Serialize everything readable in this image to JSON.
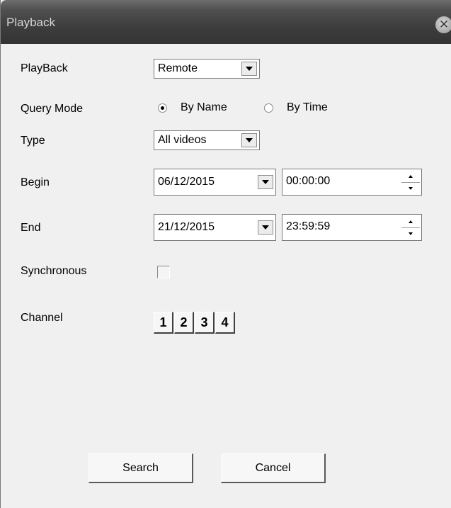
{
  "window": {
    "title": "Playback",
    "close_glyph": "✕",
    "close_icon": "close-icon"
  },
  "form": {
    "playback": {
      "label": "PlayBack",
      "value": "Remote"
    },
    "query_mode": {
      "label": "Query Mode",
      "options": [
        {
          "label": "By Name",
          "selected": true
        },
        {
          "label": "By Time",
          "selected": false
        }
      ]
    },
    "type": {
      "label": "Type",
      "value": "All videos"
    },
    "begin": {
      "label": "Begin",
      "date": "06/12/2015",
      "time": "00:00:00"
    },
    "end": {
      "label": "End",
      "date": "21/12/2015",
      "time": "23:59:59"
    },
    "synchronous": {
      "label": "Synchronous",
      "checked": false
    },
    "channel": {
      "label": "Channel",
      "buttons": [
        "1",
        "2",
        "3",
        "4"
      ]
    }
  },
  "buttons": {
    "search": "Search",
    "cancel": "Cancel"
  }
}
